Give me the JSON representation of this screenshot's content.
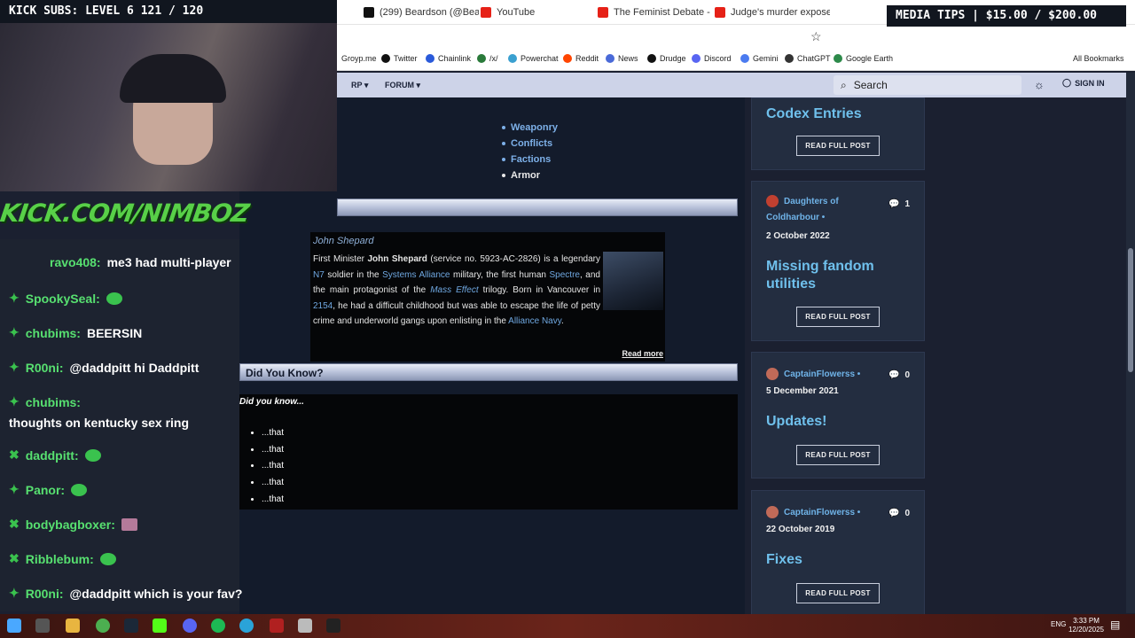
{
  "overlay": {
    "kick_subs": "KICK SUBS: LEVEL 6 121 / 120",
    "kick_url": "KICK.COM/NIMBOZ",
    "media_tips": "MEDIA TIPS | $15.00 / $200.00"
  },
  "browser": {
    "tabs": [
      {
        "label": "(299) Beardson (@Bear",
        "color": "#111111"
      },
      {
        "label": "YouTube",
        "color": "#e62117"
      },
      {
        "label": "The Feminist Debate - Y",
        "color": "#e62117"
      },
      {
        "label": "Judge's murder expose",
        "color": "#e62117"
      }
    ],
    "bookmarks": [
      "Groyp.me",
      "Twitter",
      "Chainlink",
      "/x/",
      "Powerchat",
      "Reddit",
      "News",
      "Drudge",
      "Discord",
      "Gemini",
      "ChatGPT",
      "Google Earth"
    ],
    "all_bookmarks": "All Bookmarks"
  },
  "site": {
    "nav": [
      "RP",
      "FORUM"
    ],
    "search_placeholder": "Search",
    "sign_in": "SIGN IN"
  },
  "categories": [
    "Weaponry",
    "Conflicts",
    "Factions",
    "Armor"
  ],
  "featured": {
    "name": "John Shepard",
    "text_parts": [
      "First Minister ",
      "John Shepard",
      " (service no. 5923-AC-2826) is a legendary ",
      "N7",
      " soldier in the ",
      "Systems Alliance",
      " military, the first human ",
      "Spectre",
      ", and the main protagonist of the ",
      "Mass Effect",
      " trilogy. Born in Vancouver in ",
      "2154",
      ", he had a difficult childhood but was able to escape the life of petty crime and underworld gangs upon enlisting in the ",
      "Alliance Navy",
      "."
    ],
    "read_more": "Read more"
  },
  "did_you_know": {
    "title": "Did You Know?",
    "heading": "Did you know...",
    "items": [
      "...that",
      "...that",
      "...that",
      "...that",
      "...that"
    ]
  },
  "posts": [
    {
      "title": "Codex Entries",
      "button": "READ FULL POST"
    },
    {
      "author": "Daughters of Coldharbour",
      "comments": "1",
      "date": "2 October 2022",
      "title": "Missing fandom utilities",
      "button": "READ FULL POST"
    },
    {
      "author": "CaptainFlowerss",
      "comments": "0",
      "date": "5 December 2021",
      "title": "Updates!",
      "button": "READ FULL POST"
    },
    {
      "author": "CaptainFlowerss",
      "comments": "0",
      "date": "22 October 2019",
      "title": "Fixes",
      "button": "READ FULL POST"
    }
  ],
  "chat": [
    {
      "name": "ravo408:",
      "text": "me3 had multi-player"
    },
    {
      "name": "SpookySeal:",
      "text": ""
    },
    {
      "name": "chubims:",
      "text": "BEERSIN"
    },
    {
      "name": "R00ni:",
      "text": "@daddpitt hi Daddpitt"
    },
    {
      "name": "chubims:",
      "text": ""
    },
    {
      "name": "",
      "text": "thoughts on kentucky sex ring"
    },
    {
      "name": "daddpitt:",
      "text": ""
    },
    {
      "name": "Panor:",
      "text": ""
    },
    {
      "name": "bodybagboxer:",
      "text": ""
    },
    {
      "name": "Ribblebum:",
      "text": ""
    },
    {
      "name": "R00ni:",
      "text": "@daddpitt which is your fav?"
    }
  ],
  "taskbar": {
    "lang": "ENG",
    "time": "3:33 PM",
    "date": "12/20/2025"
  }
}
